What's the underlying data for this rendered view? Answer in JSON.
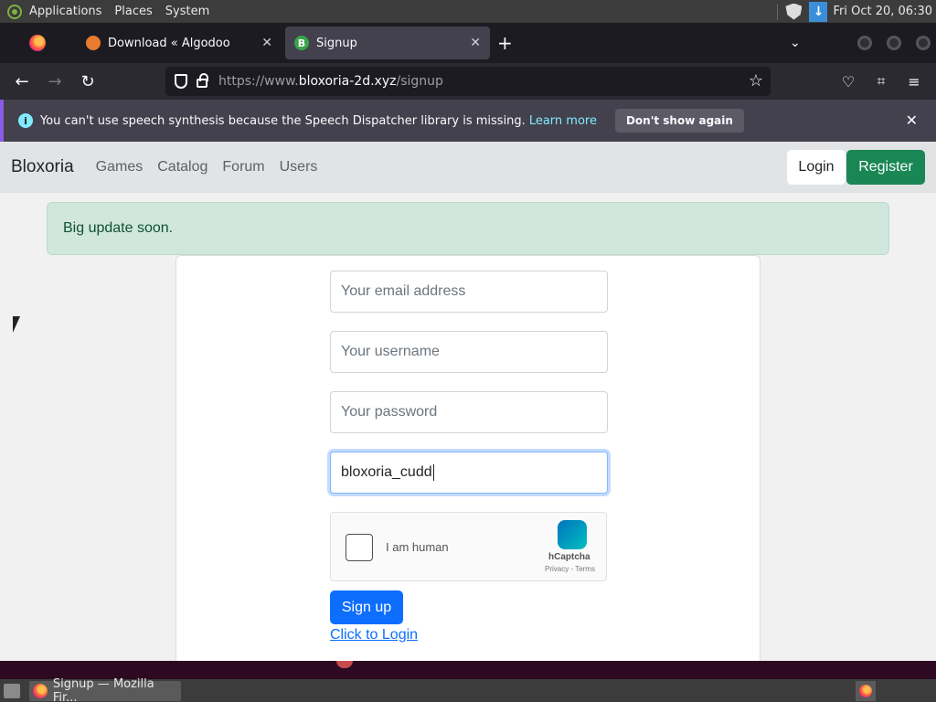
{
  "top_panel": {
    "menus": [
      "Applications",
      "Places",
      "System"
    ],
    "clock": "Fri Oct 20, 06:30"
  },
  "tabs": [
    {
      "title": "Download « Algodoo",
      "favicon": "algodoo-icon",
      "active": false
    },
    {
      "title": "Signup",
      "favicon": "bloxoria-b-icon",
      "active": true
    }
  ],
  "tab_favicon_letters": {
    "bloxoria": "B",
    "algodoo": "A"
  },
  "navbar": {
    "url_prefix": "https://www.",
    "url_host": "bloxoria-2d.xyz",
    "url_path": "/signup"
  },
  "notification": {
    "message": "You can't use speech synthesis because the Speech Dispatcher library is missing.",
    "learn_more": "Learn more",
    "dont_show": "Don't show again"
  },
  "site": {
    "brand": "Bloxoria",
    "nav_links": [
      "Games",
      "Catalog",
      "Forum",
      "Users"
    ],
    "login": "Login",
    "register": "Register",
    "alert": "Big update soon."
  },
  "form": {
    "email_placeholder": "Your email address",
    "username_placeholder": "Your username",
    "password_placeholder": "Your password",
    "active_value": "bloxoria_cudd",
    "captcha_label": "I am human",
    "captcha_brand": "hCaptcha",
    "captcha_links": "Privacy - Terms",
    "signup": "Sign up",
    "login_link": "Click to Login"
  },
  "taskbar": {
    "window_title": "Signup — Mozilla Fir..."
  },
  "colors": {
    "register_green": "#198754",
    "signup_blue": "#0d6efd",
    "alert_bg": "#d1e7dd"
  }
}
